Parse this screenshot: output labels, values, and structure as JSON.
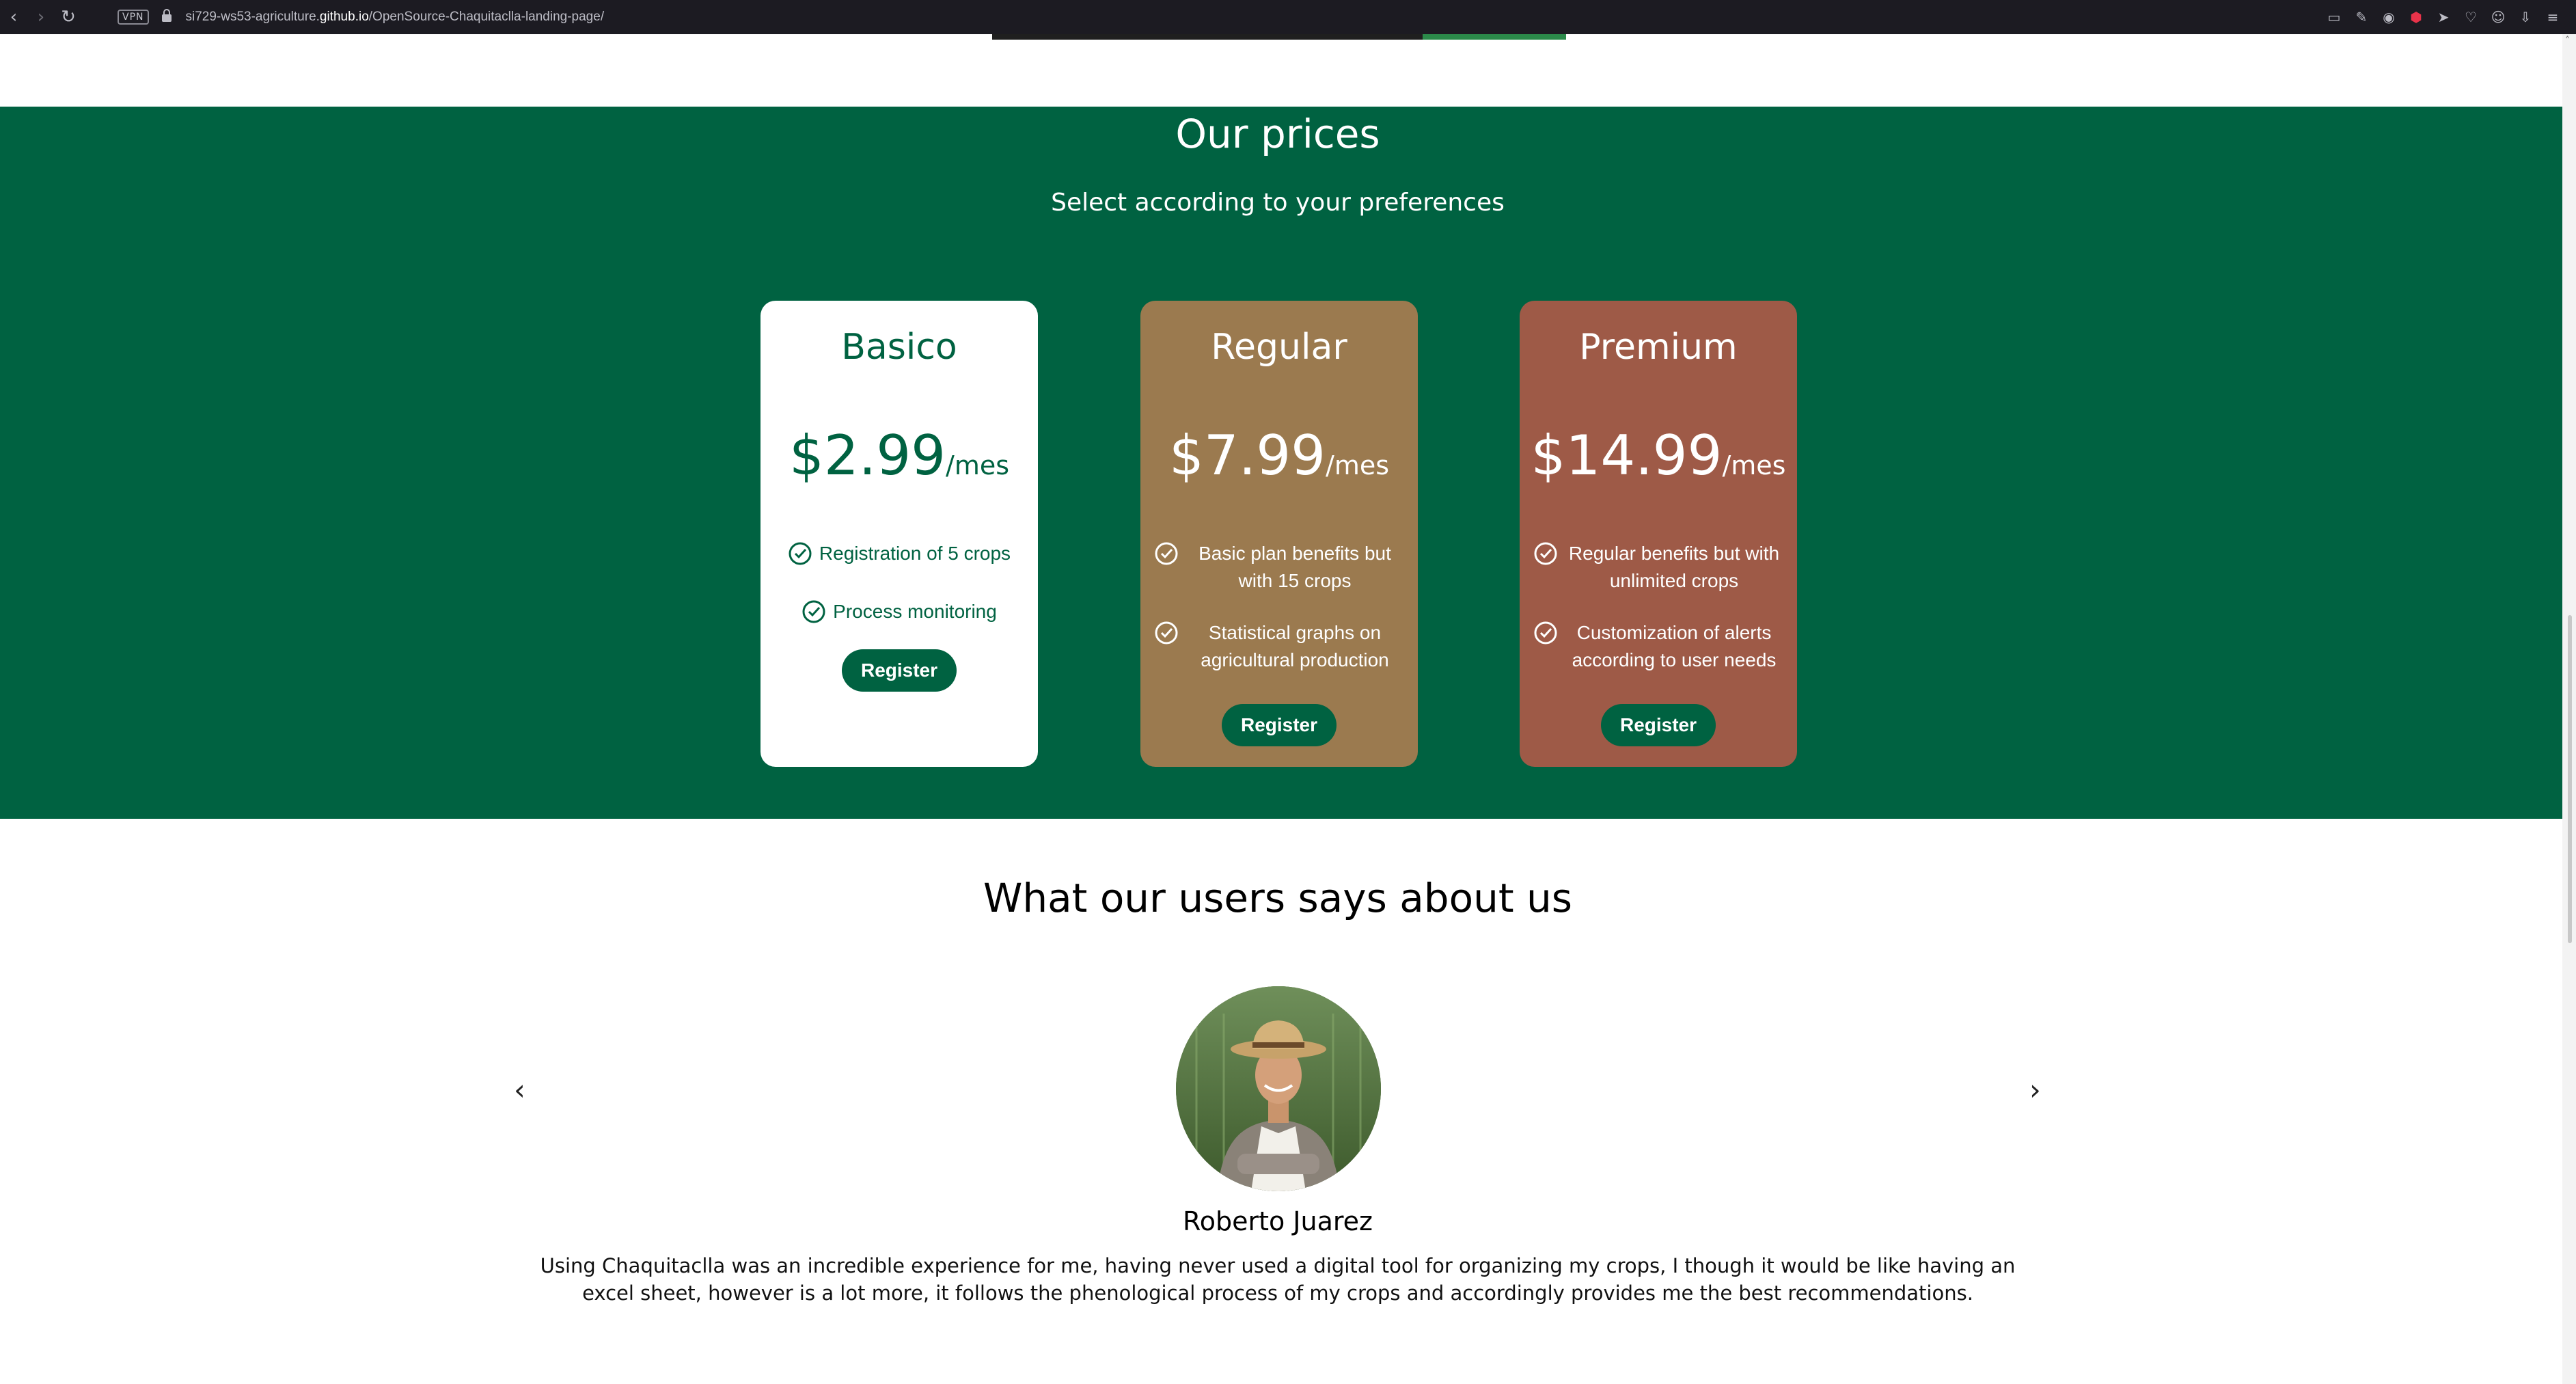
{
  "browser": {
    "vpn_label": "VPN",
    "url_prefix": "si729-ws53-agriculture.",
    "url_domain": "github.io",
    "url_path": "/OpenSource-Chaquitaclla-landing-page/"
  },
  "prices": {
    "title": "Our prices",
    "subtitle": "Select according to your preferences",
    "plans": [
      {
        "name": "Basico",
        "amount": "$2.99",
        "unit": "/mes",
        "features": [
          "Registration of 5 crops",
          "Process monitoring"
        ],
        "button": "Register",
        "color": "#ffffff"
      },
      {
        "name": "Regular",
        "amount": "$7.99",
        "unit": "/mes",
        "features": [
          "Basic plan benefits but with 15 crops",
          "Statistical graphs on agricultural production"
        ],
        "button": "Register",
        "color": "#9b7a4f"
      },
      {
        "name": "Premium",
        "amount": "$14.99",
        "unit": "/mes",
        "features": [
          "Regular benefits but with unlimited crops",
          "Customization of alerts according to user needs"
        ],
        "button": "Register",
        "color": "#9e5a47"
      }
    ],
    "accent": "#006241"
  },
  "testimonials": {
    "title": "What our users says about us",
    "prev_label": "‹",
    "next_label": "›",
    "name": "Roberto Juarez",
    "quote": "Using Chaquitaclla was an incredible experience for me, having never used a digital tool for organizing my crops, I though it would be like having an excel sheet, however is a lot more, it follows the phenological process  of my crops and accordingly provides me the best recommendations."
  }
}
